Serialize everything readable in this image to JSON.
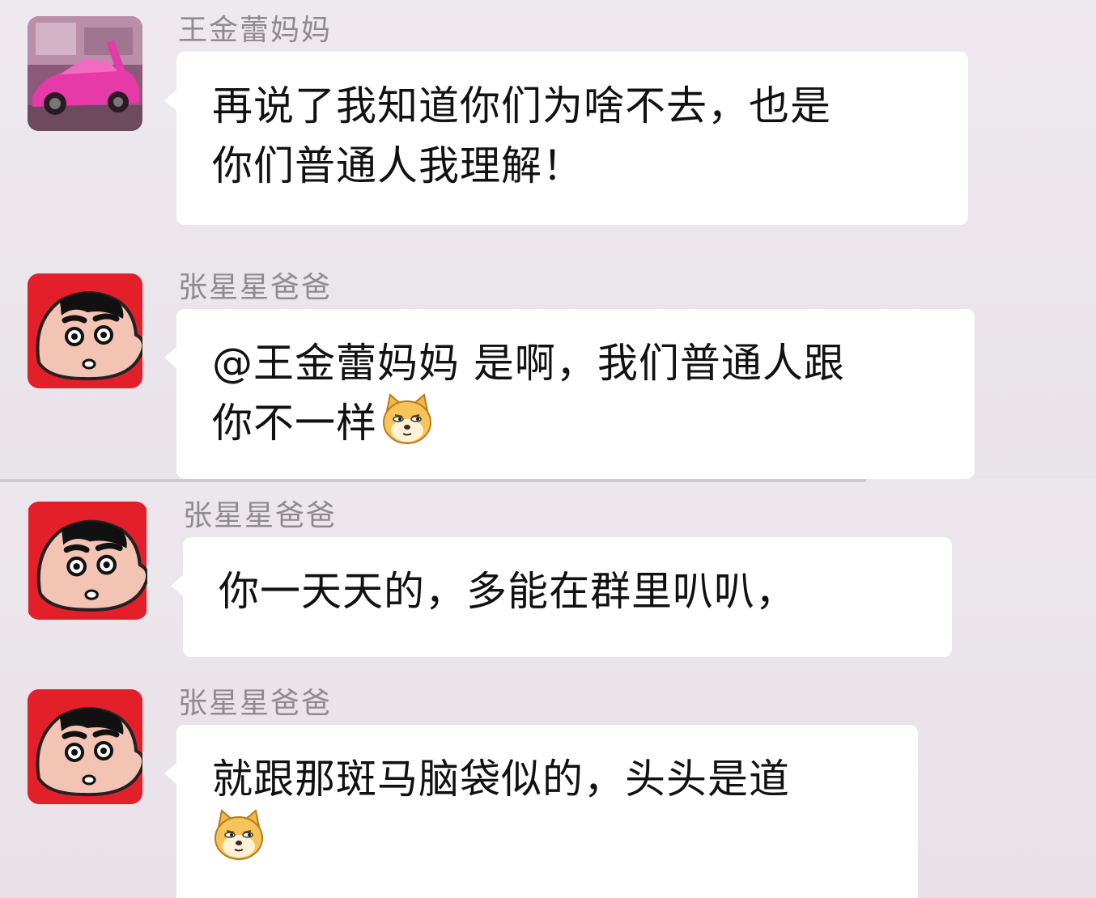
{
  "messages": [
    {
      "sender": "王金蕾妈妈",
      "avatar_icon": "pink-sports-car-avatar",
      "lines": [
        "再说了我知道你们为啥不去，也是",
        "你们普通人我理解！"
      ]
    },
    {
      "sender": "张星星爸爸",
      "avatar_icon": "cartoon-boy-face-avatar",
      "lines": [
        "@王金蕾妈妈 是啊，我们普通人跟",
        "你不一样"
      ],
      "emoji": "doge-emoji"
    },
    {
      "sender": "张星星爸爸",
      "avatar_icon": "cartoon-boy-face-avatar",
      "lines": [
        "你一天天的，多能在群里叭叭，"
      ]
    },
    {
      "sender": "张星星爸爸",
      "avatar_icon": "cartoon-boy-face-avatar",
      "lines": [
        "就跟那斑马脑袋似的，头头是道"
      ],
      "emoji": "doge-emoji"
    }
  ],
  "colors": {
    "background": "#ece7ec",
    "bubble": "#ffffff",
    "sender_name": "#8e8b90",
    "avatar_red": "#e3202a",
    "car_pink": "#e63aa8"
  }
}
